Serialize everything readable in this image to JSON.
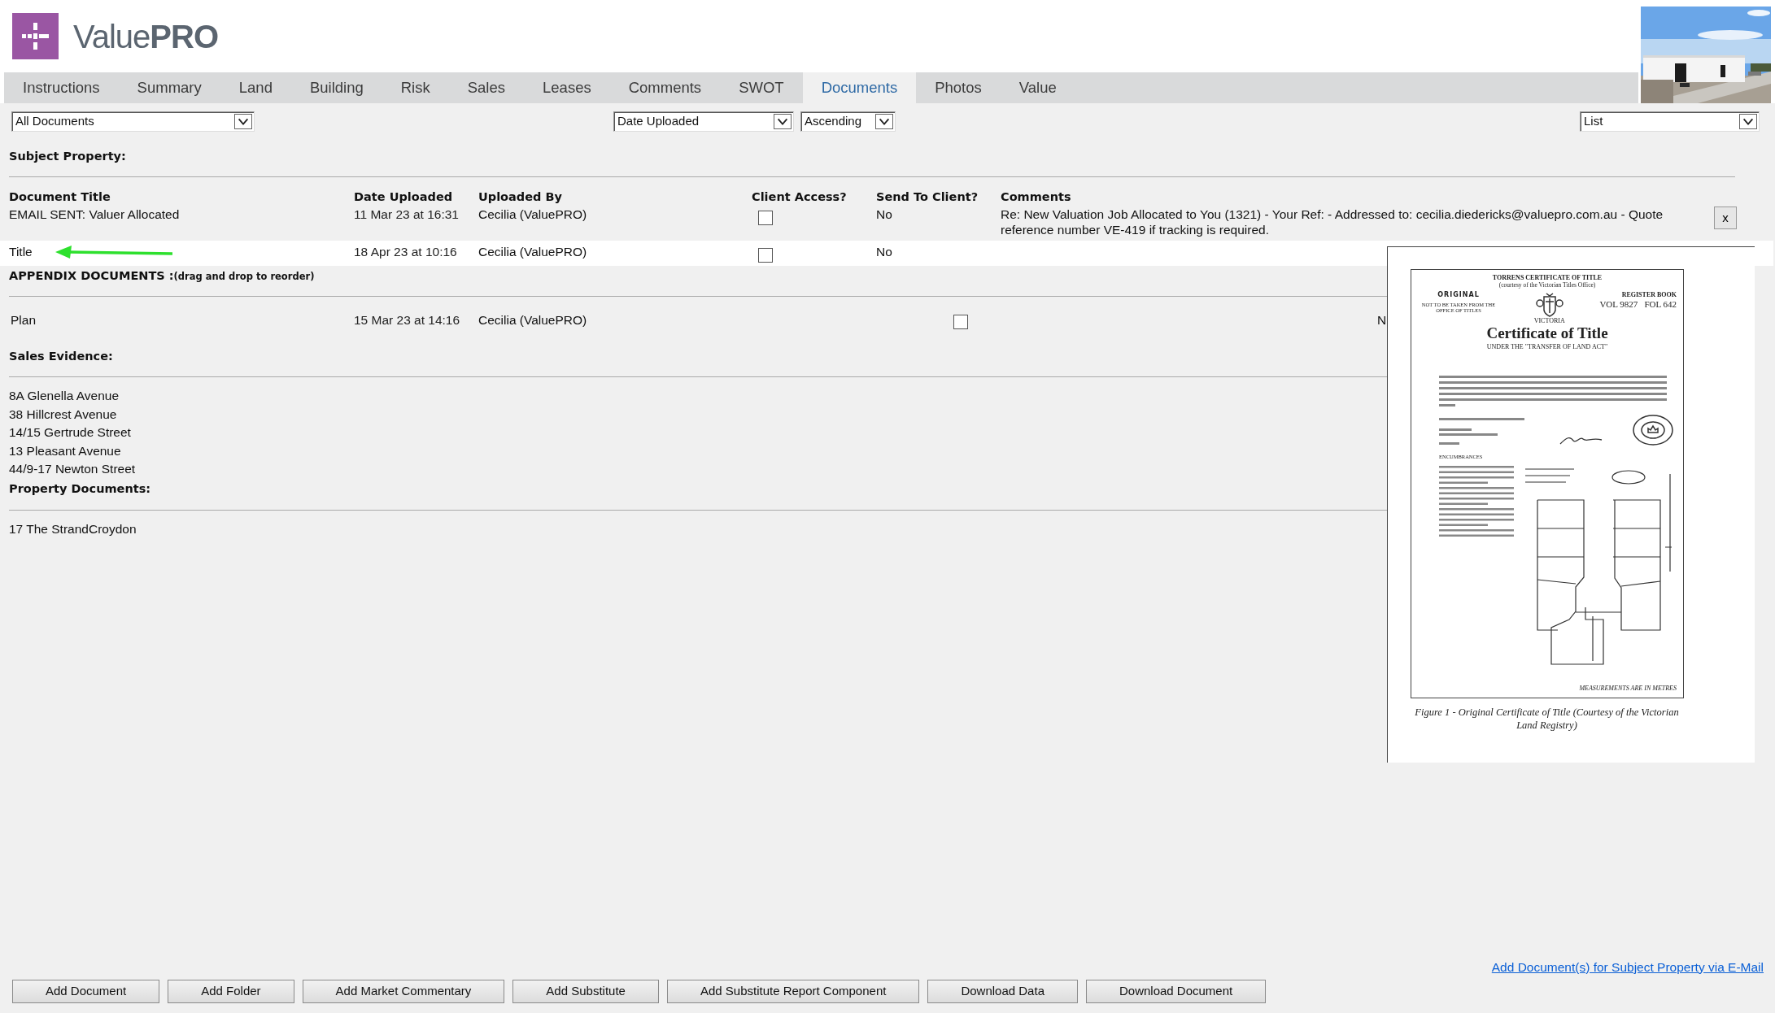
{
  "header": {
    "logo_text": "Value**PRO**"
  },
  "tabs": [
    {
      "label": "Instructions",
      "selected": false
    },
    {
      "label": "Summary",
      "selected": false
    },
    {
      "label": "Land",
      "selected": false
    },
    {
      "label": "Building",
      "selected": false
    },
    {
      "label": "Risk",
      "selected": false
    },
    {
      "label": "Sales",
      "selected": false
    },
    {
      "label": "Leases",
      "selected": false
    },
    {
      "label": "Comments",
      "selected": false
    },
    {
      "label": "SWOT",
      "selected": false
    },
    {
      "label": "Documents",
      "selected": true
    },
    {
      "label": "Photos",
      "selected": false
    },
    {
      "label": "Value",
      "selected": false
    }
  ],
  "filters": {
    "document_filter": "All Documents",
    "sort_by": "Date Uploaded",
    "order": "Ascending",
    "view": "List"
  },
  "subject_property": {
    "heading": "Subject Property:",
    "columns": [
      "Document Title",
      "Date Uploaded",
      "Uploaded By",
      "Client Access?",
      "Send To Client?",
      "Comments"
    ],
    "rows": [
      {
        "title": "EMAIL SENT: Valuer Allocated",
        "date": "11 Mar 23 at 16:31",
        "uploaded_by": "Cecilia (ValuePRO)",
        "client_access": false,
        "send_to_client": "No",
        "comments": "Re: New Valuation Job Allocated to You (1321) - Your Ref: - Addressed to: cecilia.diedericks@valuepro.com.au - Quote reference number VE-419 if tracking is required.",
        "remove_label": "x",
        "selected": false
      },
      {
        "title": "Title",
        "arrow_annotation": true,
        "date": "18 Apr 23 at 10:16",
        "uploaded_by": "Cecilia (ValuePRO)",
        "client_access": false,
        "send_to_client": "No",
        "selected": true
      }
    ]
  },
  "appendix": {
    "heading": "APPENDIX DOCUMENTS :",
    "note": "(drag and drop to reorder)",
    "rows": [
      {
        "title": "Plan",
        "date": "15 Mar 23 at 14:16",
        "uploaded_by": "Cecilia (ValuePRO)",
        "client_access": false,
        "send_to_client": "N"
      }
    ]
  },
  "sales_evidence": {
    "heading": "Sales Evidence:",
    "items": [
      "8A Glenella Avenue",
      "38 Hillcrest Avenue",
      "14/15 Gertrude Street",
      "13 Pleasant Avenue",
      "44/9-17 Newton Street"
    ]
  },
  "property_documents": {
    "heading": "Property Documents:",
    "items": [
      "17 The StrandCroydon"
    ]
  },
  "preview": {
    "heading": "TORRENS CERTIFICATE OF TITLE",
    "subheading": "(courtesy of the Victorian Titles Office)",
    "stamp": "ORIGINAL",
    "warning": "NOT TO BE TAKEN FROM THE OFFICE OF TITLES",
    "register": "REGISTER BOOK",
    "volume": "VOL 9827",
    "folio": "FOL 642",
    "state": "VICTORIA",
    "document_title": "Certificate of Title",
    "act": "UNDER THE \"TRANSFER OF LAND ACT\"",
    "section": "ENCUMBRANCES",
    "note": "MEASUREMENTS ARE IN METRES",
    "caption": "Figure 1 - Original Certificate of Title (Courtesy of the Victorian Land Registry)"
  },
  "footer": {
    "email_link": "Add Document(s) for Subject Property via E-Mail",
    "buttons": [
      "Add Document",
      "Add Folder",
      "Add Market Commentary",
      "Add Substitute",
      "Add Substitute Report Component",
      "Download Data",
      "Download Document"
    ]
  }
}
